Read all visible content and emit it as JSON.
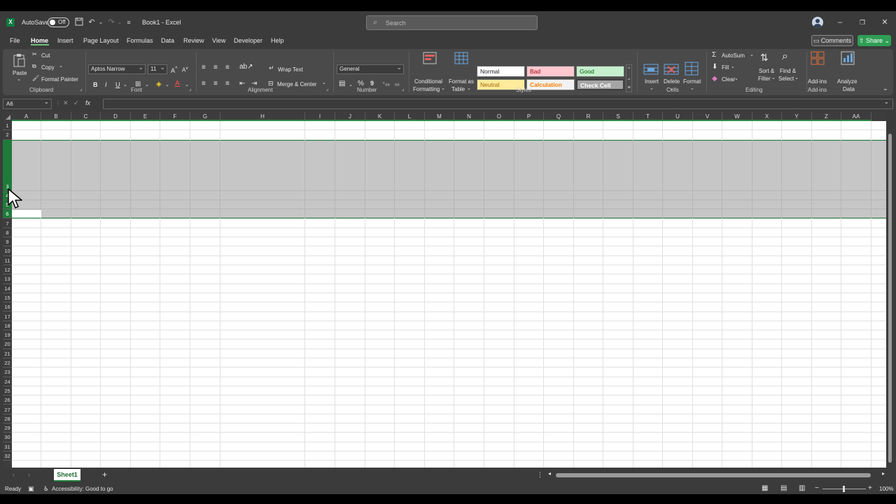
{
  "titlebar": {
    "autosave_label": "AutoSave",
    "toggle_state": "Off",
    "doc_title": "Book1 - Excel",
    "search_placeholder": "Search"
  },
  "menu": {
    "tabs": [
      "File",
      "Home",
      "Insert",
      "Page Layout",
      "Formulas",
      "Data",
      "Review",
      "View",
      "Developer",
      "Help"
    ],
    "active": "Home",
    "comments": "Comments",
    "share": "Share"
  },
  "ribbon": {
    "clipboard": {
      "paste": "Paste",
      "cut": "Cut",
      "copy": "Copy",
      "format_painter": "Format Painter",
      "label": "Clipboard"
    },
    "font": {
      "name": "Aptos Narrow",
      "size": "11",
      "bold": "B",
      "italic": "I",
      "underline": "U",
      "label": "Font"
    },
    "alignment": {
      "wrap_text": "Wrap Text",
      "merge_center": "Merge & Center",
      "label": "Alignment"
    },
    "number": {
      "format": "General",
      "label": "Number"
    },
    "styles": {
      "conditional_1": "Conditional",
      "conditional_2": "Formatting",
      "format_table_1": "Format as",
      "format_table_2": "Table",
      "normal": "Normal",
      "bad": "Bad",
      "good": "Good",
      "neutral": "Neutral",
      "calculation": "Calculation",
      "check_cell": "Check Cell",
      "label": "Styles"
    },
    "cells": {
      "insert": "Insert",
      "delete": "Delete",
      "format": "Format",
      "label": "Cells"
    },
    "editing": {
      "autosum": "AutoSum",
      "fill": "Fill",
      "clear": "Clear",
      "sort_1": "Sort &",
      "sort_2": "Filter",
      "find_1": "Find &",
      "find_2": "Select",
      "label": "Editing"
    },
    "addins": {
      "addins": "Add-ins",
      "analyze_1": "Analyze",
      "analyze_2": "Data",
      "label": "Add-ins"
    }
  },
  "formula": {
    "namebox": "A6",
    "fx": "fx"
  },
  "grid": {
    "columns": [
      "A",
      "B",
      "C",
      "D",
      "E",
      "F",
      "G",
      "H",
      "I",
      "J",
      "K",
      "L",
      "M",
      "N",
      "O",
      "P",
      "Q",
      "R",
      "S",
      "T",
      "U",
      "V",
      "W",
      "X",
      "Y",
      "Z",
      "AA"
    ],
    "rows": [
      "1",
      "2",
      "3",
      "4",
      "5",
      "6",
      "7",
      "8",
      "9",
      "10",
      "11",
      "12",
      "13",
      "14",
      "15",
      "16",
      "17",
      "18",
      "19",
      "20",
      "21",
      "22",
      "23",
      "24",
      "25",
      "26",
      "27",
      "28",
      "29",
      "30",
      "31",
      "32"
    ],
    "selected_rows": [
      "3",
      "4",
      "5",
      "6"
    ],
    "active_cell": "A6"
  },
  "sheets": {
    "tabs": [
      "Sheet1"
    ],
    "add": "+"
  },
  "status": {
    "ready": "Ready",
    "accessibility": "Accessibility: Good to go",
    "zoom": "100%"
  }
}
